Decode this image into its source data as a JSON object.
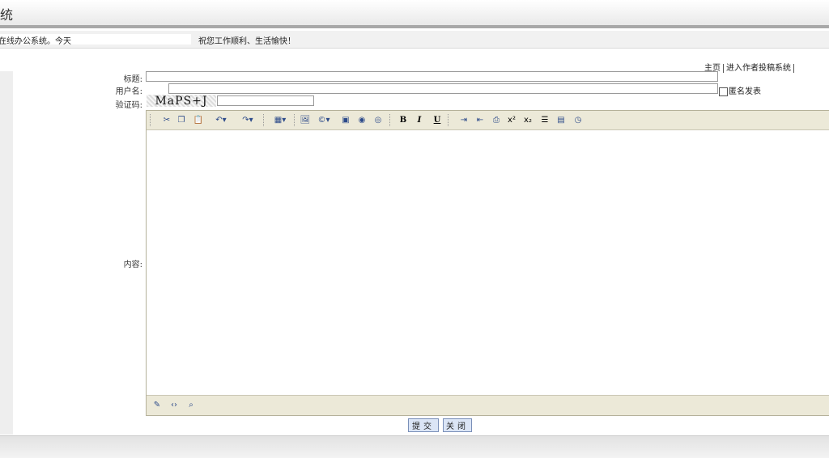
{
  "header": {
    "title": "统"
  },
  "infobar": {
    "welcome": "在线办公系统。今天",
    "wish": "祝您工作顺利、生活愉快！"
  },
  "links": {
    "home": "主页",
    "author": "进入作者投稿系统"
  },
  "form": {
    "title_label": "标题:",
    "title_value": "",
    "user_label": "用户名:",
    "user_value": "",
    "captcha_label": "验证码:",
    "captcha_text": "MaPS+J",
    "captcha_value": "",
    "anon_label": "匿名发表",
    "content_label": "内容:"
  },
  "editor": {
    "toolbar": [
      "cut-icon",
      "copy-icon",
      "paste-icon",
      "undo-icon",
      "redo-icon",
      "table-icon",
      "image-icon",
      "symbol-icon",
      "media-icon",
      "link-icon",
      "unlink-icon",
      "bold-icon",
      "italic-icon",
      "underline-icon",
      "indent-icon",
      "outdent-icon",
      "print-icon",
      "superscript-icon",
      "subscript-icon",
      "list-icon",
      "paste-word-icon",
      "time-icon"
    ],
    "bold": "B",
    "italic": "I",
    "underline": "U",
    "modes": [
      "design-mode-icon",
      "html-mode-icon",
      "preview-mode-icon"
    ]
  },
  "buttons": {
    "submit": "提交",
    "close": "关闭"
  }
}
